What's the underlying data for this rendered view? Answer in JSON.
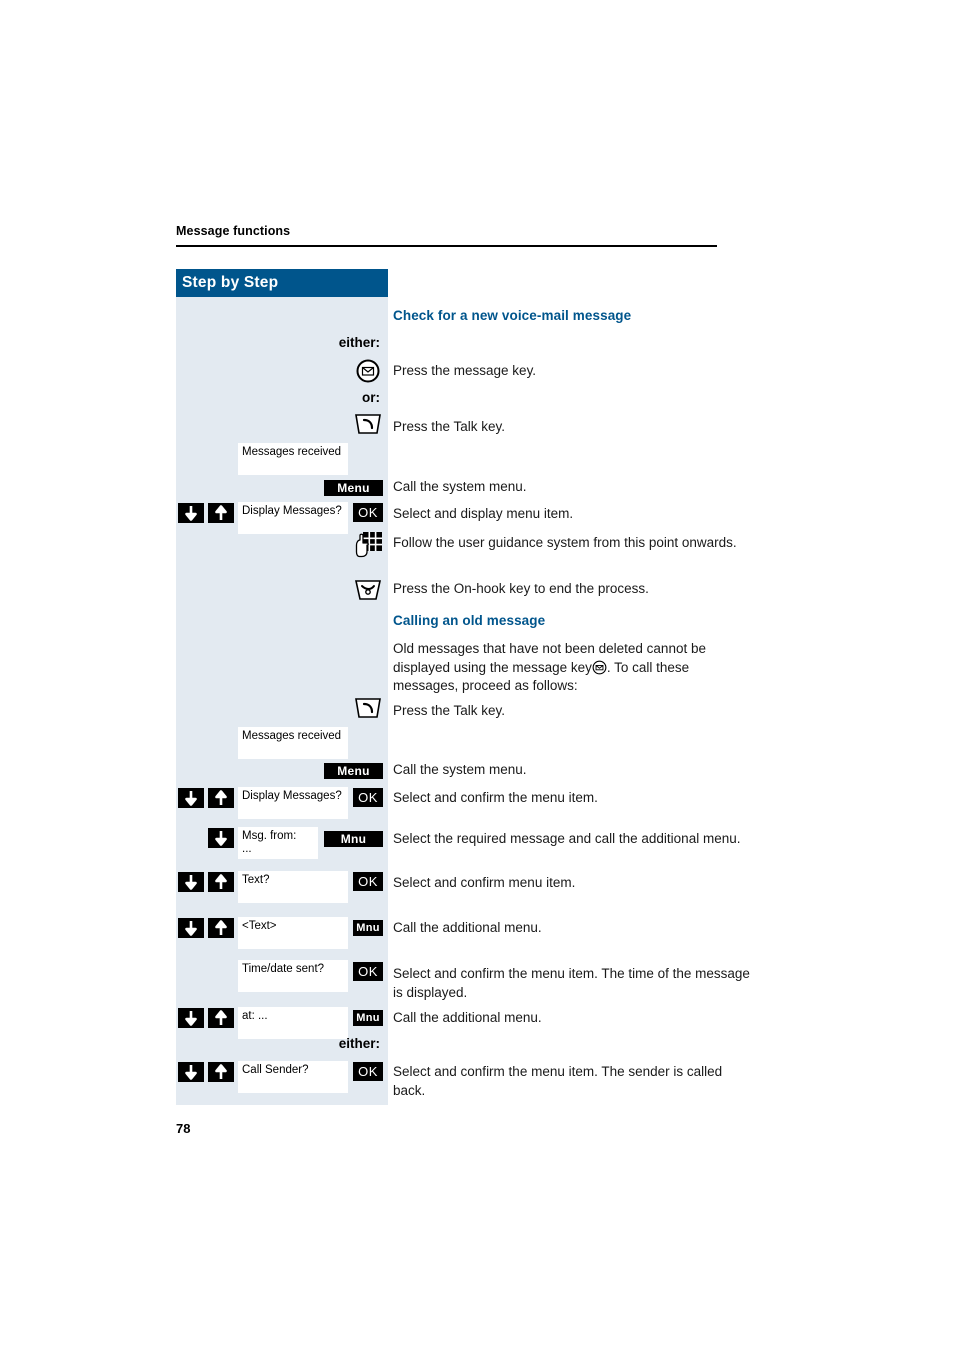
{
  "page": {
    "running_head": "Message functions",
    "number": "78",
    "accent_color": "#00558c",
    "panel_color": "#e3eaf1"
  },
  "sidebar": {
    "title": "Step by Step"
  },
  "sections": [
    {
      "title": "Check for a new voice-mail message"
    },
    {
      "title": "Calling an old message",
      "paragraph": "Old messages that have not been deleted cannot be displayed using the message key  . To call these messages, proceed as follows:"
    }
  ],
  "labels": {
    "either_1": "either:",
    "or_1": "or:",
    "either_2": "either:"
  },
  "steps": [
    {
      "id": "press-message-key",
      "icon": "message-key-icon",
      "text": "Press the message key."
    },
    {
      "id": "press-talk-key-1",
      "icon": "talk-key-icon",
      "text": "Press the Talk key."
    },
    {
      "id": "messages-received-1",
      "display_line1": "Messages received",
      "display_line2": "",
      "text": ""
    },
    {
      "id": "call-system-menu-1",
      "softkey": "Menu",
      "text": "Call the system menu."
    },
    {
      "id": "display-messages-1",
      "arrows": [
        "down",
        "up"
      ],
      "display_line1": "Display Messages?",
      "display_line2": "",
      "softkey": "OK",
      "text": "Select and display menu item."
    },
    {
      "id": "user-guidance",
      "icon": "keypad-icon",
      "text": "Follow the user guidance system from this point onwards."
    },
    {
      "id": "on-hook",
      "icon": "on-hook-key-icon",
      "text": "Press the On-hook key to end the process."
    },
    {
      "id": "press-talk-key-2",
      "icon": "talk-key-icon",
      "text": "Press the Talk key."
    },
    {
      "id": "messages-received-2",
      "display_line1": "Messages received",
      "display_line2": "",
      "text": ""
    },
    {
      "id": "call-system-menu-2",
      "softkey": "Menu",
      "text": "Call the system menu."
    },
    {
      "id": "display-messages-2",
      "arrows": [
        "down",
        "up"
      ],
      "display_line1": "Display Messages?",
      "display_line2": "",
      "softkey": "OK",
      "text": "Select and confirm the menu item."
    },
    {
      "id": "msg-from",
      "arrows": [
        "down"
      ],
      "display_line1": "Msg. from:",
      "display_line2": "...",
      "softkey": "Mnu",
      "text": "Select the required message and call the additional menu."
    },
    {
      "id": "text-item",
      "arrows": [
        "down",
        "up"
      ],
      "display_line1": "Text?",
      "display_line2": "",
      "softkey": "OK",
      "text": "Select and confirm menu item."
    },
    {
      "id": "text-angle",
      "arrows": [
        "down",
        "up"
      ],
      "display_line1": "<Text>",
      "display_line2": "",
      "softkey": "Mnu",
      "text": "Call the additional menu."
    },
    {
      "id": "time-date-sent",
      "display_line1": "Time/date sent?",
      "display_line2": "",
      "softkey": "OK",
      "text": "Select and confirm the menu item. The time of the message is displayed."
    },
    {
      "id": "at-item",
      "arrows": [
        "down",
        "up"
      ],
      "display_line1": "at: ...",
      "display_line2": "",
      "softkey": "Mnu",
      "text": "Call the additional menu."
    },
    {
      "id": "call-sender",
      "arrows": [
        "down",
        "up"
      ],
      "display_line1": "Call Sender?",
      "display_line2": "",
      "softkey": "OK",
      "text": "Select and confirm the menu item. The sender is called back."
    }
  ]
}
